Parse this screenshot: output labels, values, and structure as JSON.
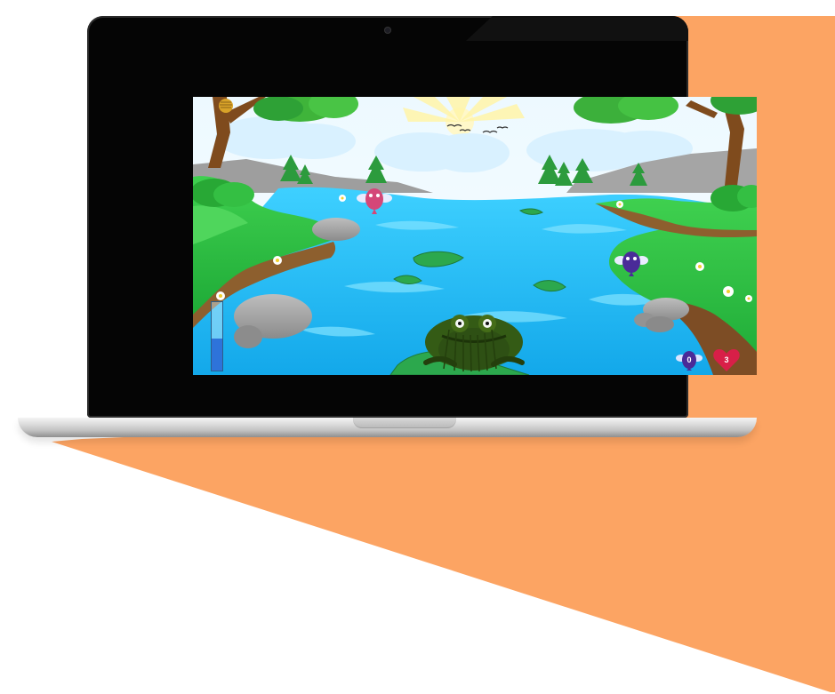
{
  "scene": {
    "name": "pond-frog-game",
    "colors": {
      "accent_orange": "#fca463",
      "water": "#2fc4f5",
      "grass": "#2cbf45",
      "hud_heart": "#d81f48",
      "meter_fill": "#2e73da"
    }
  },
  "hud": {
    "score_value": "0",
    "lives_value": "3",
    "tongue_meter_level": 0.47,
    "score_icon": "fly-icon",
    "lives_icon": "heart-icon"
  }
}
